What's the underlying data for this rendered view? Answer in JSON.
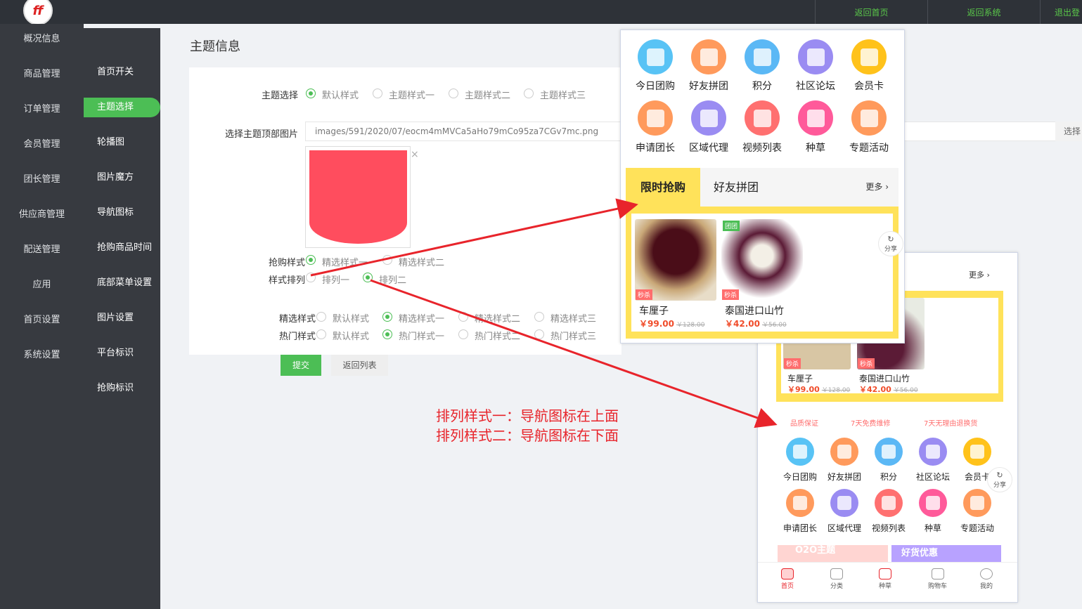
{
  "topbar": {
    "links": [
      "返回首页",
      "返回系统",
      "退出登"
    ]
  },
  "sidebar": {
    "items": [
      "概况信息",
      "商品管理",
      "订单管理",
      "会员管理",
      "团长管理",
      "供应商管理",
      "配送管理",
      "应用",
      "首页设置",
      "系统设置"
    ]
  },
  "subnav": {
    "items": [
      "首页开关",
      "主题选择",
      "轮播图",
      "图片魔方",
      "导航图标",
      "抢购商品时间",
      "底部菜单设置",
      "图片设置",
      "平台标识",
      "抢购标识"
    ],
    "active": "主题选择"
  },
  "page": {
    "title": "主题信息"
  },
  "form": {
    "theme_label": "主题选择",
    "theme_options": [
      "默认样式",
      "主题样式一",
      "主题样式二",
      "主题样式三"
    ],
    "theme_selected": "默认样式",
    "header_image_label": "选择主题顶部图片",
    "header_image_value": "images/591/2020/07/eocm4mMVCa5aHo79mCo95za7CGv7mc.png",
    "pick_button": "选择",
    "close_glyph": "×",
    "flash_label": "抢购样式",
    "flash_options": [
      "精选样式一",
      "精选样式二"
    ],
    "flash_selected": "精选样式一",
    "arrange_label": "样式排列",
    "arrange_options": [
      "排列一",
      "排列二"
    ],
    "arrange_selected": "排列二",
    "featured_label": "精选样式",
    "featured_options": [
      "默认样式",
      "精选样式一",
      "精选样式二",
      "精选样式三"
    ],
    "featured_selected": "精选样式一",
    "hot_label": "热门样式",
    "hot_options": [
      "默认样式",
      "热门样式一",
      "热门样式二",
      "热门样式三"
    ],
    "hot_selected": "热门样式一",
    "submit": "提交",
    "back": "返回列表"
  },
  "annotation": {
    "line1": "排列样式一：导航图标在上面",
    "line2": "排列样式二：导航图标在下面"
  },
  "preview": {
    "nav_icons": [
      {
        "label": "今日团购",
        "icon": "pie-chart-icon",
        "color": "#58c3f5"
      },
      {
        "label": "好友拼团",
        "icon": "user-icon",
        "color": "#ff9a5c"
      },
      {
        "label": "积分",
        "icon": "coins-icon",
        "color": "#5bb8f5"
      },
      {
        "label": "社区论坛",
        "icon": "store-icon",
        "color": "#9a8cf2"
      },
      {
        "label": "会员卡",
        "icon": "card-icon",
        "color": "#ffc21a"
      },
      {
        "label": "申请团长",
        "icon": "form-icon",
        "color": "#ff9a5c"
      },
      {
        "label": "区域代理",
        "icon": "building-icon",
        "color": "#9a8cf2"
      },
      {
        "label": "视频列表",
        "icon": "grid-building-icon",
        "color": "#ff7070"
      },
      {
        "label": "种草",
        "icon": "heart-icon",
        "color": "#ff5a9a"
      },
      {
        "label": "专题活动",
        "icon": "edit-icon",
        "color": "#ff9a5c"
      }
    ],
    "tab_active": "限时抢购",
    "tab_other": "好友拼团",
    "more": "更多",
    "more_arrow": "›",
    "products": [
      {
        "name": "车厘子",
        "price": "￥99.00",
        "old": "￥128.00",
        "tag": "秒杀"
      },
      {
        "name": "泰国进口山竹",
        "price": "￥42.00",
        "old": "￥56.00",
        "tag": "秒杀",
        "badge": "团团"
      }
    ],
    "share": "分享",
    "guarantees": [
      "品质保证",
      "7天免费维修",
      "7天无理由退换货"
    ],
    "banners": [
      "O2O主题",
      "好货优惠"
    ],
    "bottom_nav": [
      "首页",
      "分类",
      "种草",
      "购物车",
      "我的"
    ]
  }
}
